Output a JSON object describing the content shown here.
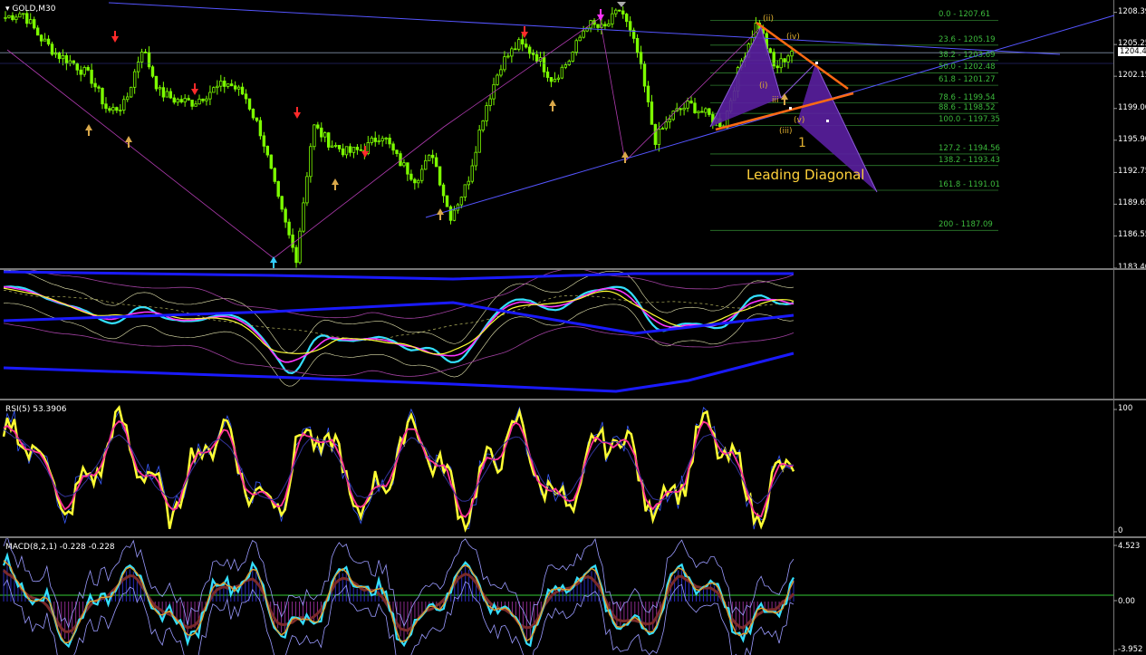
{
  "main": {
    "symbol": "GOLD,M30",
    "current_price": "1204.45",
    "price_ticks": [
      "1208.39",
      "1205.25",
      "1202.15",
      "1199.00",
      "1195.90",
      "1192.75",
      "1189.65",
      "1186.55",
      "1183.40"
    ],
    "price_ticks_num": [
      1208.39,
      1205.25,
      1202.15,
      1199.0,
      1195.9,
      1192.75,
      1189.65,
      1186.55,
      1183.4
    ],
    "fib_labels": [
      "0.0 - 1207.61",
      "23.6 - 1205.19",
      "38.2 - 1203.69",
      "50.0 - 1202.48",
      "61.8 - 1201.27",
      "78.6 - 1199.54",
      "88.6 - 1198.52",
      "100.0 - 1197.35",
      "127.2 - 1194.56",
      "138.2 - 1193.43",
      "161.8 - 1191.01",
      "200 - 1187.09"
    ],
    "fib_values": [
      1207.61,
      1205.19,
      1203.69,
      1202.48,
      1201.27,
      1199.54,
      1198.52,
      1197.35,
      1194.56,
      1193.43,
      1191.01,
      1187.09
    ],
    "wave_labels": [
      "(ii)",
      "(iv)",
      "(i)",
      "iii",
      "(v)",
      "(iii)",
      "1"
    ],
    "annotation": "Leading Diagonal"
  },
  "rsi": {
    "title": "RSI(5) 53.3906",
    "ticks": [
      "100",
      "0"
    ]
  },
  "macd": {
    "title": "MACD(8,2,1) -0.228 -0.228",
    "ticks": [
      "4.523",
      "0.00",
      "-3.952"
    ]
  },
  "colors": {
    "bull": "#7CFC00",
    "bear": "#7CFC00",
    "fib": "#2e7d2e",
    "trend": "#5555ff",
    "pattern": "#5a1fa0",
    "orange": "#ff6a13",
    "yellow": "#ffff33",
    "cyan": "#33e0ff",
    "magenta": "#ff33ff"
  },
  "chart_data": {
    "type": "line",
    "title": "GOLD,M30",
    "ylim": [
      1183.4,
      1209.6
    ],
    "series": [
      {
        "name": "GOLD,M30",
        "values": [
          1207.9,
          1208.4,
          1206.0,
          1204.3,
          1203.4,
          1202.0,
          1198.7,
          1199.4,
          1205.0,
          1200.6,
          1199.8,
          1199.6,
          1200.7,
          1201.5,
          1200.3,
          1196.4,
          1189.7,
          1184.3,
          1197.3,
          1195.6,
          1194.7,
          1195.0,
          1196.6,
          1193.9,
          1192.1,
          1194.6,
          1188.4,
          1191.6,
          1198.7,
          1203.4,
          1205.3,
          1204.3,
          1201.8,
          1203.8,
          1207.3,
          1206.7,
          1208.8,
          1204.3,
          1195.9,
          1198.4,
          1199.4,
          1198.4,
          1197.4,
          1203.4,
          1207.6,
          1202.8,
          1204.7
        ]
      }
    ]
  }
}
